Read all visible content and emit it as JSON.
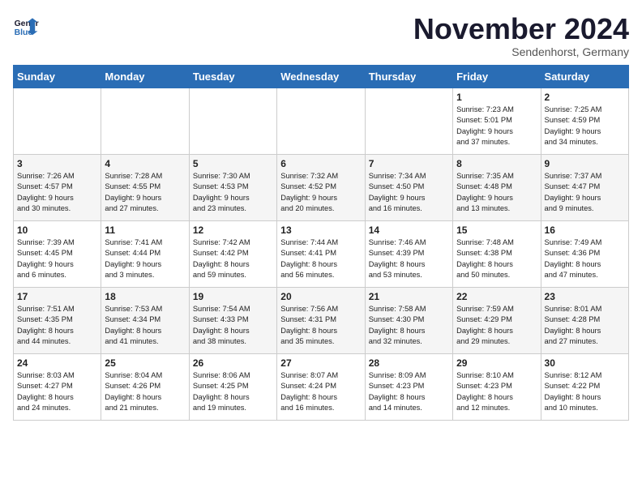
{
  "logo": {
    "line1": "General",
    "line2": "Blue"
  },
  "title": "November 2024",
  "subtitle": "Sendenhorst, Germany",
  "days_of_week": [
    "Sunday",
    "Monday",
    "Tuesday",
    "Wednesday",
    "Thursday",
    "Friday",
    "Saturday"
  ],
  "weeks": [
    [
      {
        "num": "",
        "info": ""
      },
      {
        "num": "",
        "info": ""
      },
      {
        "num": "",
        "info": ""
      },
      {
        "num": "",
        "info": ""
      },
      {
        "num": "",
        "info": ""
      },
      {
        "num": "1",
        "info": "Sunrise: 7:23 AM\nSunset: 5:01 PM\nDaylight: 9 hours\nand 37 minutes."
      },
      {
        "num": "2",
        "info": "Sunrise: 7:25 AM\nSunset: 4:59 PM\nDaylight: 9 hours\nand 34 minutes."
      }
    ],
    [
      {
        "num": "3",
        "info": "Sunrise: 7:26 AM\nSunset: 4:57 PM\nDaylight: 9 hours\nand 30 minutes."
      },
      {
        "num": "4",
        "info": "Sunrise: 7:28 AM\nSunset: 4:55 PM\nDaylight: 9 hours\nand 27 minutes."
      },
      {
        "num": "5",
        "info": "Sunrise: 7:30 AM\nSunset: 4:53 PM\nDaylight: 9 hours\nand 23 minutes."
      },
      {
        "num": "6",
        "info": "Sunrise: 7:32 AM\nSunset: 4:52 PM\nDaylight: 9 hours\nand 20 minutes."
      },
      {
        "num": "7",
        "info": "Sunrise: 7:34 AM\nSunset: 4:50 PM\nDaylight: 9 hours\nand 16 minutes."
      },
      {
        "num": "8",
        "info": "Sunrise: 7:35 AM\nSunset: 4:48 PM\nDaylight: 9 hours\nand 13 minutes."
      },
      {
        "num": "9",
        "info": "Sunrise: 7:37 AM\nSunset: 4:47 PM\nDaylight: 9 hours\nand 9 minutes."
      }
    ],
    [
      {
        "num": "10",
        "info": "Sunrise: 7:39 AM\nSunset: 4:45 PM\nDaylight: 9 hours\nand 6 minutes."
      },
      {
        "num": "11",
        "info": "Sunrise: 7:41 AM\nSunset: 4:44 PM\nDaylight: 9 hours\nand 3 minutes."
      },
      {
        "num": "12",
        "info": "Sunrise: 7:42 AM\nSunset: 4:42 PM\nDaylight: 8 hours\nand 59 minutes."
      },
      {
        "num": "13",
        "info": "Sunrise: 7:44 AM\nSunset: 4:41 PM\nDaylight: 8 hours\nand 56 minutes."
      },
      {
        "num": "14",
        "info": "Sunrise: 7:46 AM\nSunset: 4:39 PM\nDaylight: 8 hours\nand 53 minutes."
      },
      {
        "num": "15",
        "info": "Sunrise: 7:48 AM\nSunset: 4:38 PM\nDaylight: 8 hours\nand 50 minutes."
      },
      {
        "num": "16",
        "info": "Sunrise: 7:49 AM\nSunset: 4:36 PM\nDaylight: 8 hours\nand 47 minutes."
      }
    ],
    [
      {
        "num": "17",
        "info": "Sunrise: 7:51 AM\nSunset: 4:35 PM\nDaylight: 8 hours\nand 44 minutes."
      },
      {
        "num": "18",
        "info": "Sunrise: 7:53 AM\nSunset: 4:34 PM\nDaylight: 8 hours\nand 41 minutes."
      },
      {
        "num": "19",
        "info": "Sunrise: 7:54 AM\nSunset: 4:33 PM\nDaylight: 8 hours\nand 38 minutes."
      },
      {
        "num": "20",
        "info": "Sunrise: 7:56 AM\nSunset: 4:31 PM\nDaylight: 8 hours\nand 35 minutes."
      },
      {
        "num": "21",
        "info": "Sunrise: 7:58 AM\nSunset: 4:30 PM\nDaylight: 8 hours\nand 32 minutes."
      },
      {
        "num": "22",
        "info": "Sunrise: 7:59 AM\nSunset: 4:29 PM\nDaylight: 8 hours\nand 29 minutes."
      },
      {
        "num": "23",
        "info": "Sunrise: 8:01 AM\nSunset: 4:28 PM\nDaylight: 8 hours\nand 27 minutes."
      }
    ],
    [
      {
        "num": "24",
        "info": "Sunrise: 8:03 AM\nSunset: 4:27 PM\nDaylight: 8 hours\nand 24 minutes."
      },
      {
        "num": "25",
        "info": "Sunrise: 8:04 AM\nSunset: 4:26 PM\nDaylight: 8 hours\nand 21 minutes."
      },
      {
        "num": "26",
        "info": "Sunrise: 8:06 AM\nSunset: 4:25 PM\nDaylight: 8 hours\nand 19 minutes."
      },
      {
        "num": "27",
        "info": "Sunrise: 8:07 AM\nSunset: 4:24 PM\nDaylight: 8 hours\nand 16 minutes."
      },
      {
        "num": "28",
        "info": "Sunrise: 8:09 AM\nSunset: 4:23 PM\nDaylight: 8 hours\nand 14 minutes."
      },
      {
        "num": "29",
        "info": "Sunrise: 8:10 AM\nSunset: 4:23 PM\nDaylight: 8 hours\nand 12 minutes."
      },
      {
        "num": "30",
        "info": "Sunrise: 8:12 AM\nSunset: 4:22 PM\nDaylight: 8 hours\nand 10 minutes."
      }
    ]
  ]
}
